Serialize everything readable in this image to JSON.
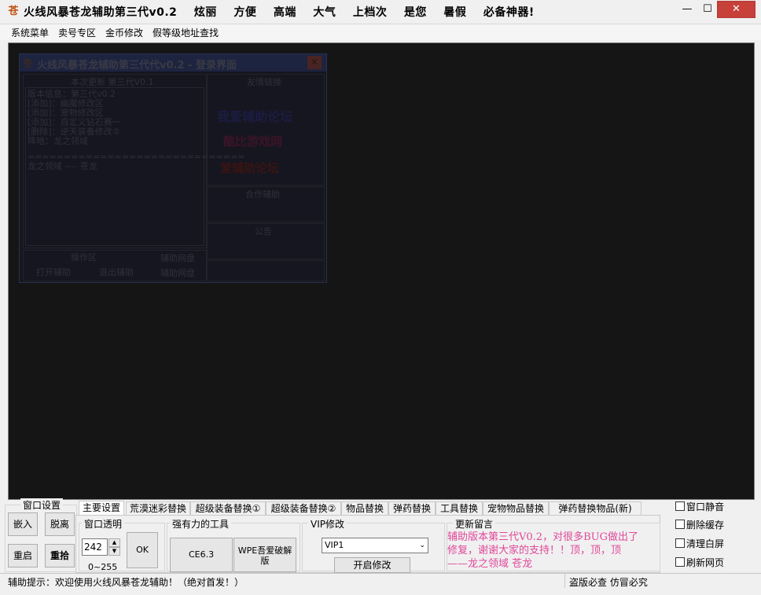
{
  "window": {
    "title": "火线风暴苍龙辅助第三代v0.2    炫丽    方便    高端    大气    上档次    是您    暑假    必备神器!",
    "icon_glyph": "苍",
    "min_glyph": "—",
    "max_glyph": "☐",
    "close_glyph": "✕"
  },
  "menu": [
    "系统菜单",
    "卖号专区",
    "金币修改",
    "假等级地址查找"
  ],
  "ghost_window": {
    "title": "火线风暴苍龙辅助第三代代v0.2 - 登录界面",
    "update_header": "本次更新 第三代V0.1",
    "update_lines": [
      "版本信息：第三代v0.2",
      "[添加]：幽魔修改区",
      "[添加]：宠物修改区",
      "[添加]：自定义钻石赛一",
      "[删除]：逆天装备修改②",
      " 阵地：龙之领域",
      "==============================",
      "龙之领域   ----   苍龙"
    ],
    "links_header": "友情链接",
    "link1": "我爱辅助论坛",
    "link2": "酷比游戏网",
    "link3": "爱辅助论坛",
    "partner_header": "合作辅助",
    "notice_header": "公告",
    "ops_header": "操作区",
    "disk_header": "辅助网盘",
    "btn_open": "打开辅助",
    "btn_exit": "退出辅助",
    "btn_disk": "辅助网盘"
  },
  "window_settings": {
    "label": "窗口设置",
    "embed": "嵌入",
    "detach": "脱离",
    "restart": "重启",
    "pickup": "重拾"
  },
  "tabs": [
    "主要设置",
    "荒漠迷彩替换",
    "超级装备替换①",
    "超级装备替换②",
    "物品替换",
    "弹药替换",
    "工具替换",
    "宠物物品替换",
    "弹药替换物品(新)"
  ],
  "transparency": {
    "label": "窗口透明",
    "value": "242",
    "range": "0~255",
    "ok": "OK"
  },
  "tools": {
    "label": "强有力的工具",
    "ce": "CE6.3",
    "wpe": "WPE吾爱破解版"
  },
  "vip": {
    "label": "VIP修改",
    "selected": "VIP1",
    "start": "开启修改"
  },
  "update_msg": {
    "label": "更新留言",
    "lines": [
      "辅助版本第三代V0.2，对很多BUG做出了",
      "修复，谢谢大家的支持！！顶，顶，顶",
      "——龙之领域  苍龙"
    ]
  },
  "checkboxes": [
    "窗口静音",
    "删除缓存",
    "清理白屏",
    "刷新网页"
  ],
  "status": {
    "hint": "辅助提示：欢迎使用火线风暴苍龙辅助！（绝对首发！）",
    "right": "盗版必查  仿冒必究"
  },
  "colors": {
    "viewport": "#151515",
    "pink_text": "#e0489a",
    "close_button": "#c7403a"
  }
}
